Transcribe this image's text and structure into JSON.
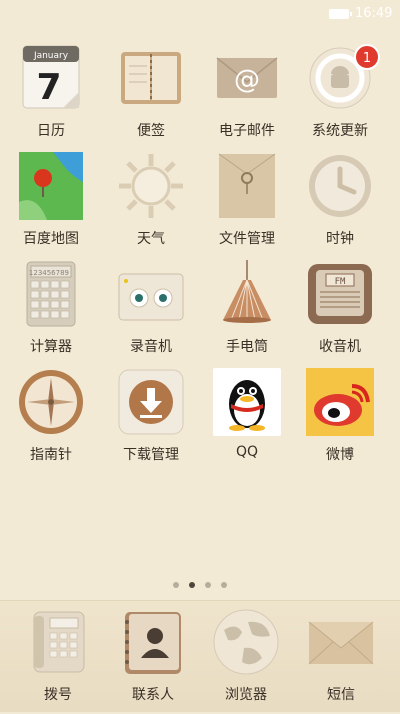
{
  "status": {
    "time": "16:49"
  },
  "apps": [
    {
      "label": "日历",
      "icon": "calendar-icon",
      "month": "January",
      "day": "7"
    },
    {
      "label": "便签",
      "icon": "notebook-icon"
    },
    {
      "label": "电子邮件",
      "icon": "email-icon",
      "glyph": "@"
    },
    {
      "label": "系统更新",
      "icon": "system-update-icon",
      "badge": "1"
    },
    {
      "label": "百度地图",
      "icon": "map-icon"
    },
    {
      "label": "天气",
      "icon": "weather-sun-icon"
    },
    {
      "label": "文件管理",
      "icon": "file-folder-icon"
    },
    {
      "label": "时钟",
      "icon": "clock-icon"
    },
    {
      "label": "计算器",
      "icon": "calculator-icon",
      "display": "123456789"
    },
    {
      "label": "录音机",
      "icon": "recorder-icon"
    },
    {
      "label": "手电筒",
      "icon": "flashlight-lamp-icon"
    },
    {
      "label": "收音机",
      "icon": "radio-icon",
      "fm": "FM"
    },
    {
      "label": "指南针",
      "icon": "compass-icon"
    },
    {
      "label": "下载管理",
      "icon": "download-icon"
    },
    {
      "label": "QQ",
      "icon": "qq-penguin-icon"
    },
    {
      "label": "微博",
      "icon": "weibo-icon"
    }
  ],
  "dock": [
    {
      "label": "拨号",
      "icon": "telephone-icon"
    },
    {
      "label": "联系人",
      "icon": "contacts-icon"
    },
    {
      "label": "浏览器",
      "icon": "globe-browser-icon"
    },
    {
      "label": "短信",
      "icon": "envelope-message-icon"
    }
  ],
  "pager": {
    "pages": 4,
    "current": 2
  }
}
